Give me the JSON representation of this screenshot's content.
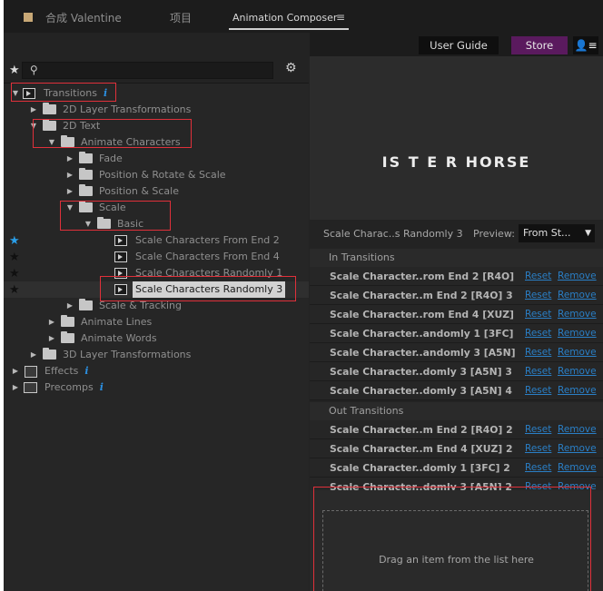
{
  "tabs": {
    "composition": "合成 Valentine",
    "project": "项目",
    "active": "Animation Composer",
    "menu_icon": "≡"
  },
  "header_buttons": {
    "user_guide": "User Guide",
    "store": "Store",
    "profile_icon": "👤≡",
    "store_color": "#5a1a5e"
  },
  "toolbar": {
    "favorites_icon": "★",
    "search_icon": "⚲",
    "settings_icon": "⚙"
  },
  "tree": {
    "transitions": "Transitions",
    "layer2d": "2D Layer Transformations",
    "text2d": "2D Text",
    "animate_characters": "Animate Characters",
    "fade": "Fade",
    "pos_rot_scale": "Position & Rotate & Scale",
    "pos_scale": "Position & Scale",
    "scale": "Scale",
    "basic": "Basic",
    "item1": "Scale Characters From End 2",
    "item2": "Scale Characters From End 4",
    "item3": "Scale Characters Randomly 1",
    "item4": "Scale Characters Randomly 3",
    "scale_tracking": "Scale & Tracking",
    "animate_lines": "Animate Lines",
    "animate_words": "Animate Words",
    "layer3d": "3D Layer Transformations",
    "effects": "Effects",
    "precomps": "Precomps",
    "info_glyph": "i"
  },
  "preview": {
    "logo_text": "IS T E R HORSE",
    "selected_name": "Scale Charac..s Randomly 3",
    "preview_label": "Preview:",
    "preview_value": "From St...",
    "dropdown_arrow": "▼"
  },
  "in_transitions": {
    "title": "In Transitions",
    "rows": [
      "Scale Character..rom End 2 [R4O]",
      "Scale Character..m End 2 [R4O] 3",
      "Scale Character..rom End 4 [XUZ]",
      "Scale Character..andomly 1 [3FC]",
      "Scale Character..andomly 3 [A5N]",
      "Scale Character..domly 3 [A5N] 3",
      "Scale Character..domly 3 [A5N] 4"
    ]
  },
  "out_transitions": {
    "title": "Out Transitions",
    "rows": [
      "Scale Character..m End 2 [R4O] 2",
      "Scale Character..m End 4 [XUZ] 2",
      "Scale Character..domly 1 [3FC] 2",
      "Scale Character..domly 3 [A5N] 2"
    ]
  },
  "row_actions": {
    "reset": "Reset",
    "remove": "Remove",
    "link_color": "#2a7fc6"
  },
  "drop_zone": {
    "text": "Drag an item from the list here"
  },
  "accent": {
    "highlight_box": "#e0303a",
    "favorite_star": "#2a9ee8"
  }
}
